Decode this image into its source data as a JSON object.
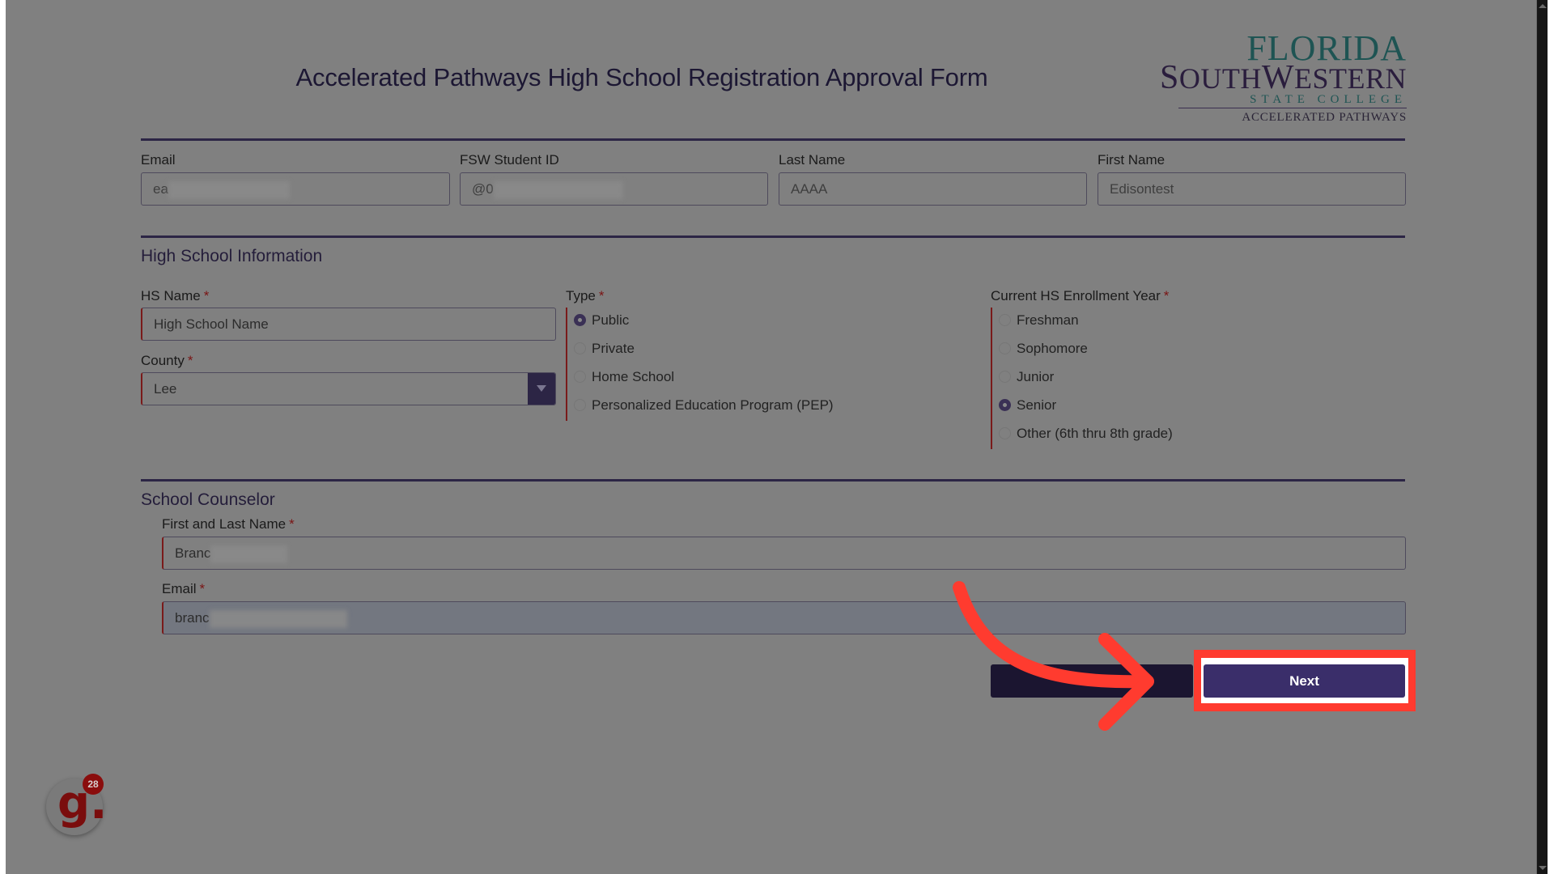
{
  "header": {
    "title": "Accelerated Pathways High School Registration Approval Form",
    "logo": {
      "line1": "FLORIDA",
      "line2_big1": "S",
      "line2_small1": "OUTH",
      "line2_big2": "W",
      "line2_small2": "ESTERN",
      "line3": "STATE COLLEGE",
      "line4": "ACCELERATED PATHWAYS"
    }
  },
  "student": {
    "email": {
      "label": "Email",
      "value": "ea"
    },
    "student_id": {
      "label": "FSW Student ID",
      "value": "@0"
    },
    "last_name": {
      "label": "Last Name",
      "value": "AAAA"
    },
    "first_name": {
      "label": "First Name",
      "value": "Edisontest"
    }
  },
  "high_school": {
    "heading": "High School Information",
    "hs_name": {
      "label": "HS Name",
      "required_mark": "*",
      "value": "High School Name"
    },
    "county": {
      "label": "County",
      "required_mark": "*",
      "value": "Lee"
    },
    "type": {
      "label": "Type",
      "required_mark": "*",
      "options": [
        "Public",
        "Private",
        "Home School",
        "Personalized Education Program (PEP)"
      ],
      "selected": "Public"
    },
    "enrollment_year": {
      "label": "Current HS Enrollment Year",
      "required_mark": "*",
      "options": [
        "Freshman",
        "Sophomore",
        "Junior",
        "Senior",
        "Other (6th thru 8th grade)"
      ],
      "selected": "Senior"
    }
  },
  "counselor": {
    "heading": "School Counselor",
    "name": {
      "label": "First and Last Name",
      "required_mark": "*",
      "value": "Branc"
    },
    "email": {
      "label": "Email",
      "required_mark": "*",
      "value": "branc"
    }
  },
  "actions": {
    "back_label": "",
    "next_label": "Next"
  },
  "annotation": {
    "highlight_color": "#ff3b2f",
    "target": "Next"
  },
  "guide_widget": {
    "letter": "g.",
    "badge_count": "28"
  }
}
